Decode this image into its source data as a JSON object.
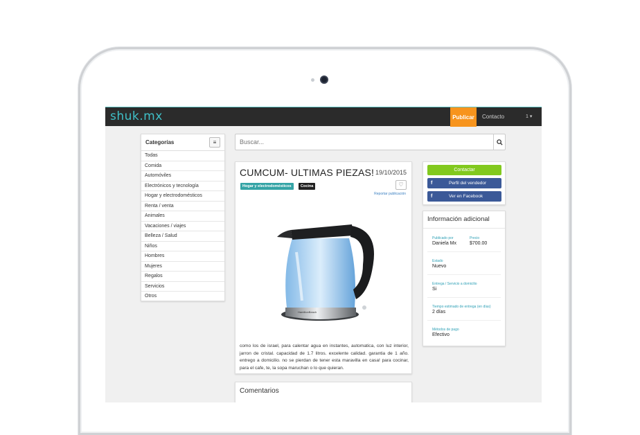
{
  "navbar": {
    "logo": "shuk.mx",
    "publicar": "Publicar",
    "contacto": "Contacto",
    "user": "1 ▾"
  },
  "categories": {
    "title": "Categorías",
    "toggle_icon": "≡",
    "items": [
      "Todas",
      "Comida",
      "Automóviles",
      "Electrónicos y tecnología",
      "Hogar y electrodomésticos",
      "Renta / venta",
      "Animales",
      "Vacaciones / viajes",
      "Belleza / Salud",
      "Niños",
      "Hombres",
      "Mujeres",
      "Regalos",
      "Servicios",
      "Otros"
    ]
  },
  "search": {
    "placeholder": "Buscar...",
    "icon": "🔍"
  },
  "post": {
    "title": "CUMCUM- ULTIMAS PIEZAS!",
    "date": "19/10/2015",
    "tags": [
      "Hogar y electrodomésticos",
      "Cocina"
    ],
    "favorite_icon": "♡",
    "report": "Reportar publicación",
    "image_alt": "electric glass kettle",
    "description": "como los de israel, para calentar agua en instantes, automatica, con luz interior, jarron de cristal. capacidad de 1.7 litros. excelente calidad. garantia de 1 año. entrego a domicilio. no se pierdan de tener esta maravilla en casa! para cocinar, para el cafe, te, la sopa maruchan o lo que quieran."
  },
  "comments": {
    "title": "Comentarios"
  },
  "actions": {
    "contactar": "Contactar",
    "perfil": "Perfil del vendedor",
    "facebook": "Ver en Facebook",
    "fb_icon": "f"
  },
  "info": {
    "title": "Información adicional",
    "publicado_label": "Publicado por",
    "publicado_value": "Daniela Mx",
    "precio_label": "Precio",
    "precio_value": "$700.00",
    "estado_label": "Estado",
    "estado_value": "Nuevo",
    "entrega_label": "Entrega / Servicio a domicilio",
    "entrega_value": "Si",
    "tiempo_label": "Tiempo estimado de entrega (en días)",
    "tiempo_value": "2 días",
    "metodos_label": "Métodos de pago",
    "metodos_value": "Efectivo"
  },
  "colors": {
    "navbar": "#2b2b2b",
    "logo": "#3fc0c8",
    "publicar": "#f7941d",
    "contactar": "#82c91e",
    "facebook": "#3b5998",
    "tag_hogar": "#35a4a6",
    "info_label": "#2c9fb5"
  }
}
